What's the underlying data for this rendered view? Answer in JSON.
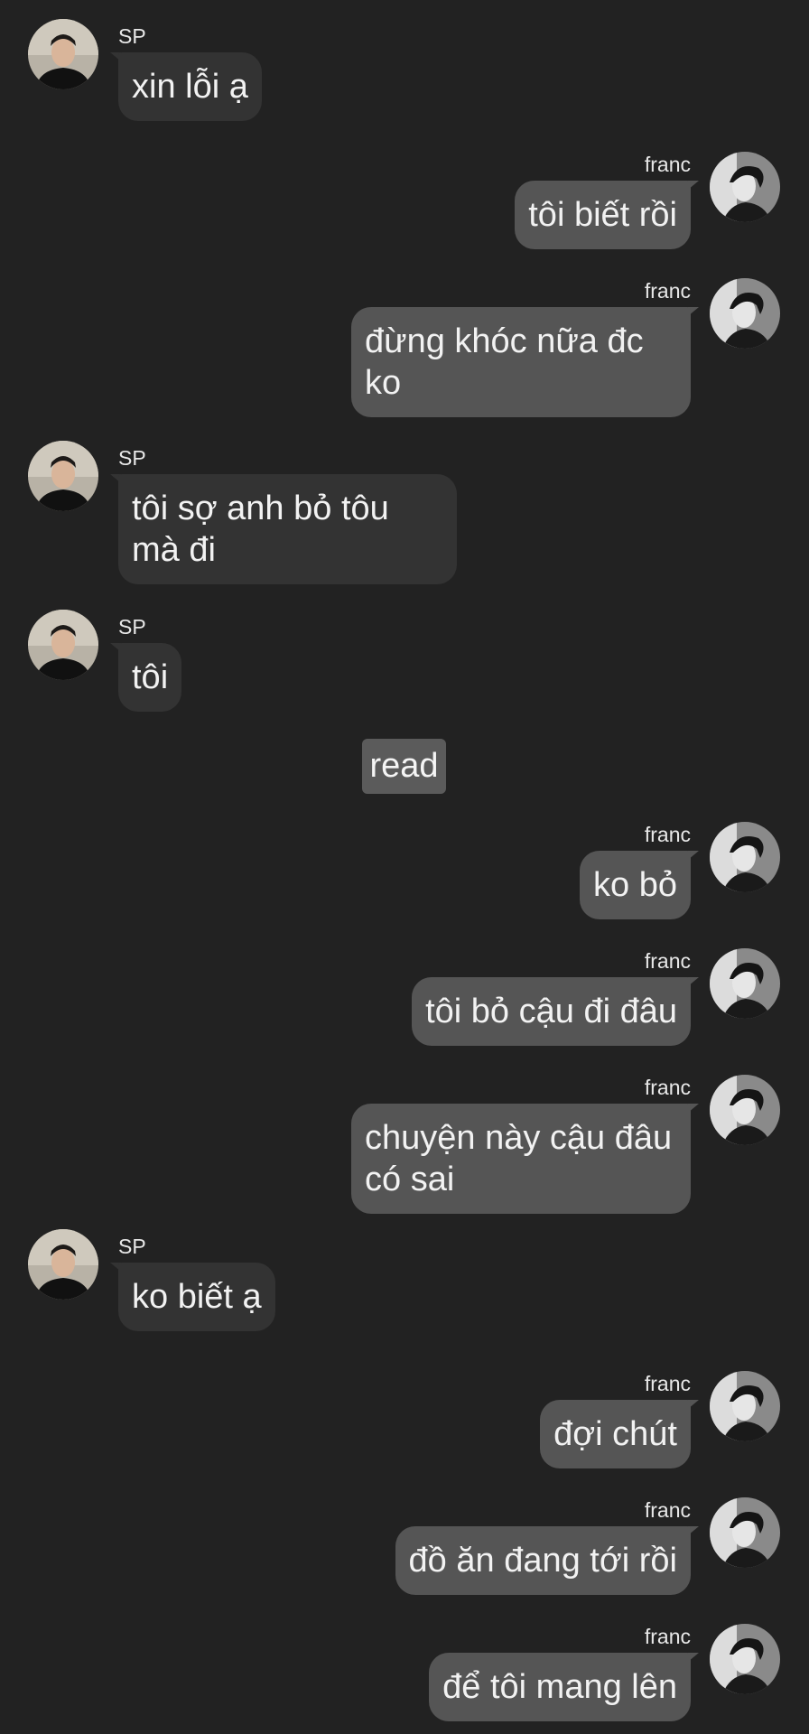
{
  "conversation": {
    "messages": [
      {
        "sender": "SP",
        "side": "left",
        "text": "xin lỗi ạ"
      },
      {
        "sender": "franc",
        "side": "right",
        "text": "tôi biết rồi"
      },
      {
        "sender": "franc",
        "side": "right",
        "text": "đừng khóc nữa đc ko"
      },
      {
        "sender": "SP",
        "side": "left",
        "text": "tôi sợ anh bỏ tôu mà đi"
      },
      {
        "sender": "SP",
        "side": "left",
        "text": "tôi"
      },
      {
        "sender": "franc",
        "side": "right",
        "text": "ko bỏ"
      },
      {
        "sender": "franc",
        "side": "right",
        "text": "tôi bỏ cậu đi đâu"
      },
      {
        "sender": "franc",
        "side": "right",
        "text": "chuyện này cậu đâu có sai"
      },
      {
        "sender": "SP",
        "side": "left",
        "text": "ko biết ạ"
      },
      {
        "sender": "franc",
        "side": "right",
        "text": "đợi chút"
      },
      {
        "sender": "franc",
        "side": "right",
        "text": "đồ ăn đang tới rồi"
      },
      {
        "sender": "franc",
        "side": "right",
        "text": "để tôi mang lên"
      }
    ],
    "read_indicator": "read"
  },
  "colors": {
    "background": "#222222",
    "incoming_bubble": "#333333",
    "outgoing_bubble": "#555555",
    "read_badge": "#5b5b5b"
  },
  "icons": {
    "sp_avatar": "avatar-photo-sp",
    "franc_avatar": "avatar-photo-franc"
  }
}
